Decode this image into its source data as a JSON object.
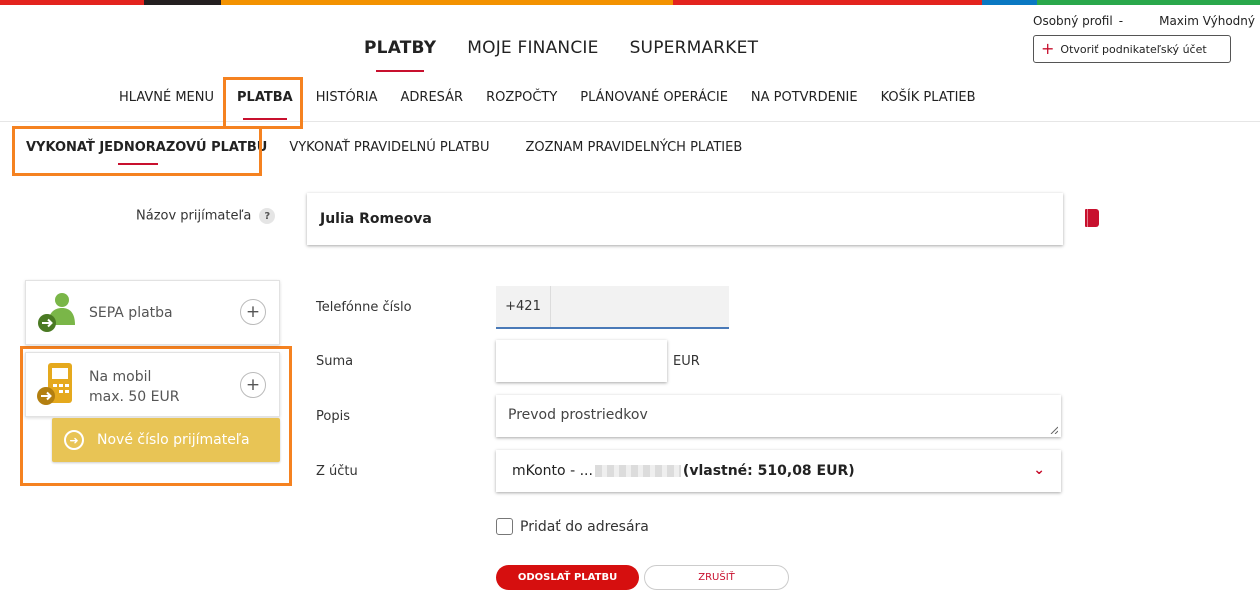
{
  "colors": {
    "accent": "#c8102e",
    "highlight": "#f58220",
    "mobile_icon": "#e5a91d",
    "sepa_icon": "#7ab648",
    "send_button": "#d60f0f",
    "new_number_button": "#e8c455",
    "stripe": [
      "#e3231e",
      "#231f20",
      "#f39200",
      "#e3231e",
      "#0a78c2",
      "#2aa84b"
    ]
  },
  "header": {
    "profile_label": "Osobný profil",
    "profile_separator": "-",
    "user_name": "Maxim Výhodný",
    "business_account_button": "Otvoriť podnikateľský účet"
  },
  "main_tabs": [
    {
      "label": "PLATBY",
      "active": true
    },
    {
      "label": "MOJE FINANCIE",
      "active": false
    },
    {
      "label": "SUPERMARKET",
      "active": false
    }
  ],
  "sub_nav": [
    {
      "label": "HLAVNÉ MENU"
    },
    {
      "label": "PLATBA",
      "active": true
    },
    {
      "label": "HISTÓRIA"
    },
    {
      "label": "ADRESÁR"
    },
    {
      "label": "ROZPOČTY"
    },
    {
      "label": "PLÁNOVANÉ OPERÁCIE"
    },
    {
      "label": "NA POTVRDENIE"
    },
    {
      "label": "KOŠÍK PLATIEB"
    }
  ],
  "payment_tabs": [
    {
      "label": "VYKONAŤ JEDNORAZOVÚ PLATBU",
      "active": true
    },
    {
      "label": "VYKONAŤ PRAVIDELNÚ PLATBU"
    },
    {
      "label": "ZOZNAM PRAVIDELNÝCH PLATIEB"
    }
  ],
  "recipient": {
    "label": "Názov prijímateľa",
    "help": "?",
    "value": "Julia Romeova",
    "book_icon": "address-book-icon"
  },
  "payment_types": {
    "sepa": {
      "label": "SEPA platba",
      "icon": "person-arrow-icon",
      "plus": "+"
    },
    "mobile": {
      "label": "Na mobil",
      "sublabel": "max. 50 EUR",
      "icon": "mobile-phone-icon",
      "plus": "+"
    },
    "new_number_button": "Nové číslo prijímateľa"
  },
  "form": {
    "phone_label": "Telefónne číslo",
    "phone_prefix": "+421",
    "phone_value": "",
    "amount_label": "Suma",
    "amount_value": "",
    "currency": "EUR",
    "description_label": "Popis",
    "description_value": "Prevod prostriedkov",
    "account_label": "Z účtu",
    "account_prefix": "mKonto - ...",
    "account_balance": "(vlastné: 510,08 EUR)",
    "add_to_addressbook": "Pridať do adresára"
  },
  "actions": {
    "send": "ODOSLAŤ PLATBU",
    "cancel": "ZRUŠIŤ"
  }
}
